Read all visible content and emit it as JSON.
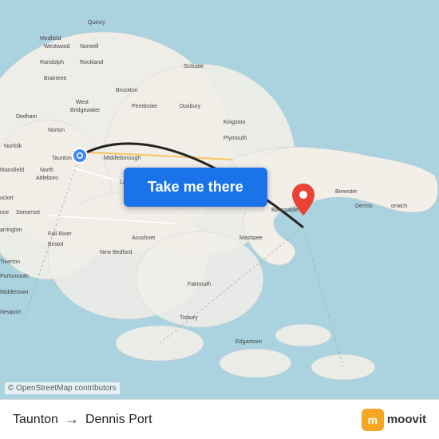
{
  "map": {
    "attribution": "© OpenStreetMap contributors",
    "button_label": "Take me there",
    "origin": "Taunton",
    "destination": "Dennis Port",
    "arrow": "→"
  },
  "footer": {
    "origin_label": "Taunton",
    "destination_label": "Dennis Port",
    "arrow": "→",
    "moovit_label": "moovit"
  },
  "colors": {
    "button_bg": "#1a73e8",
    "button_text": "#ffffff",
    "map_water": "#aad3df",
    "map_land": "#f2efe9",
    "origin_pin": "#4285f4",
    "dest_pin": "#ea4335"
  }
}
